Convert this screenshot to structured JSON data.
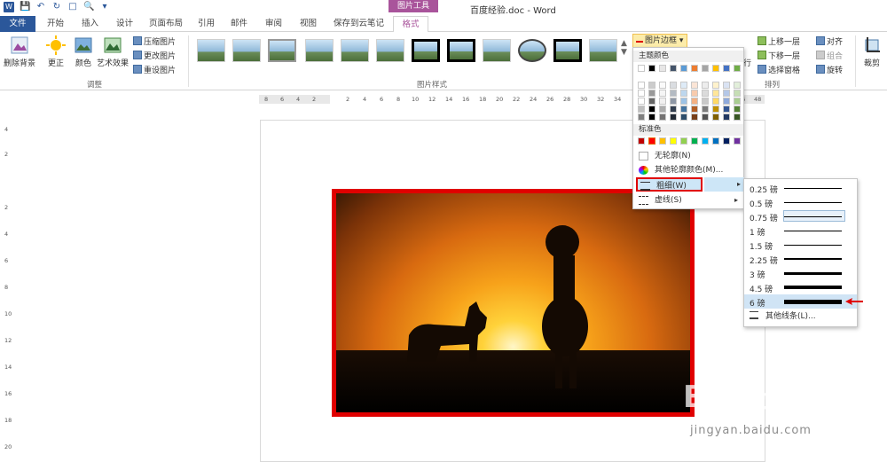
{
  "app": {
    "doc_title": "百度经验.doc - Word",
    "context_tab_group": "图片工具"
  },
  "tabs": [
    "文件",
    "开始",
    "插入",
    "设计",
    "页面布局",
    "引用",
    "邮件",
    "审阅",
    "视图",
    "保存到云笔记",
    "格式"
  ],
  "ribbon": {
    "remove_bg": "删除背景",
    "corrections": "更正",
    "color": "颜色",
    "artistic": "艺术效果",
    "compress": "压缩图片",
    "change_pic": "更改图片",
    "reset_pic": "重设图片",
    "group_adjust": "调整",
    "group_styles": "图片样式",
    "picture_border": "图片边框",
    "bring_forward": "上移一层",
    "send_backward": "下移一层",
    "selection_pane": "选择窗格",
    "align": "对齐",
    "group": "组合",
    "rotate": "旋转",
    "crop": "裁剪",
    "group_arrange": "排列",
    "wrap_text": "行"
  },
  "ruler": {
    "h_ticks": [
      "8",
      "6",
      "4",
      "2",
      "2",
      "4",
      "6",
      "8",
      "10",
      "12",
      "14",
      "16",
      "18",
      "20",
      "22",
      "24",
      "26",
      "28",
      "30",
      "32",
      "34",
      "46",
      "48"
    ],
    "v_ticks": [
      "4",
      "2",
      "2",
      "4",
      "6",
      "8",
      "10",
      "12",
      "14",
      "16",
      "18",
      "20"
    ]
  },
  "border_menu": {
    "theme_colors_header": "主题颜色",
    "standard_colors_header": "标准色",
    "no_outline": "无轮廓(N)",
    "more_colors": "其他轮廓颜色(M)...",
    "weight": "粗细(W)",
    "dashes": "虚线(S)",
    "theme_top_row": [
      "#ffffff",
      "#000000",
      "#e7e6e6",
      "#44546a",
      "#5b9bd5",
      "#ed7d31",
      "#a5a5a5",
      "#ffc000",
      "#4472c4",
      "#70ad47"
    ],
    "standard_colors": [
      "#c00000",
      "#ff0000",
      "#ffc000",
      "#ffff00",
      "#92d050",
      "#00b050",
      "#00b0f0",
      "#0070c0",
      "#002060",
      "#7030a0"
    ]
  },
  "weight_menu": {
    "items": [
      {
        "label": "0.25 磅",
        "weight": 0.25
      },
      {
        "label": "0.5 磅",
        "weight": 0.5
      },
      {
        "label": "0.75 磅",
        "weight": 0.75
      },
      {
        "label": "1 磅",
        "weight": 1
      },
      {
        "label": "1.5 磅",
        "weight": 1.5
      },
      {
        "label": "2.25 磅",
        "weight": 2.25
      },
      {
        "label": "3 磅",
        "weight": 3
      },
      {
        "label": "4.5 磅",
        "weight": 4.5
      },
      {
        "label": "6 磅",
        "weight": 6
      }
    ],
    "more": "其他线条(L)..."
  },
  "watermark": {
    "brand": "Bai经验",
    "url": "jingyan.baidu.com"
  }
}
